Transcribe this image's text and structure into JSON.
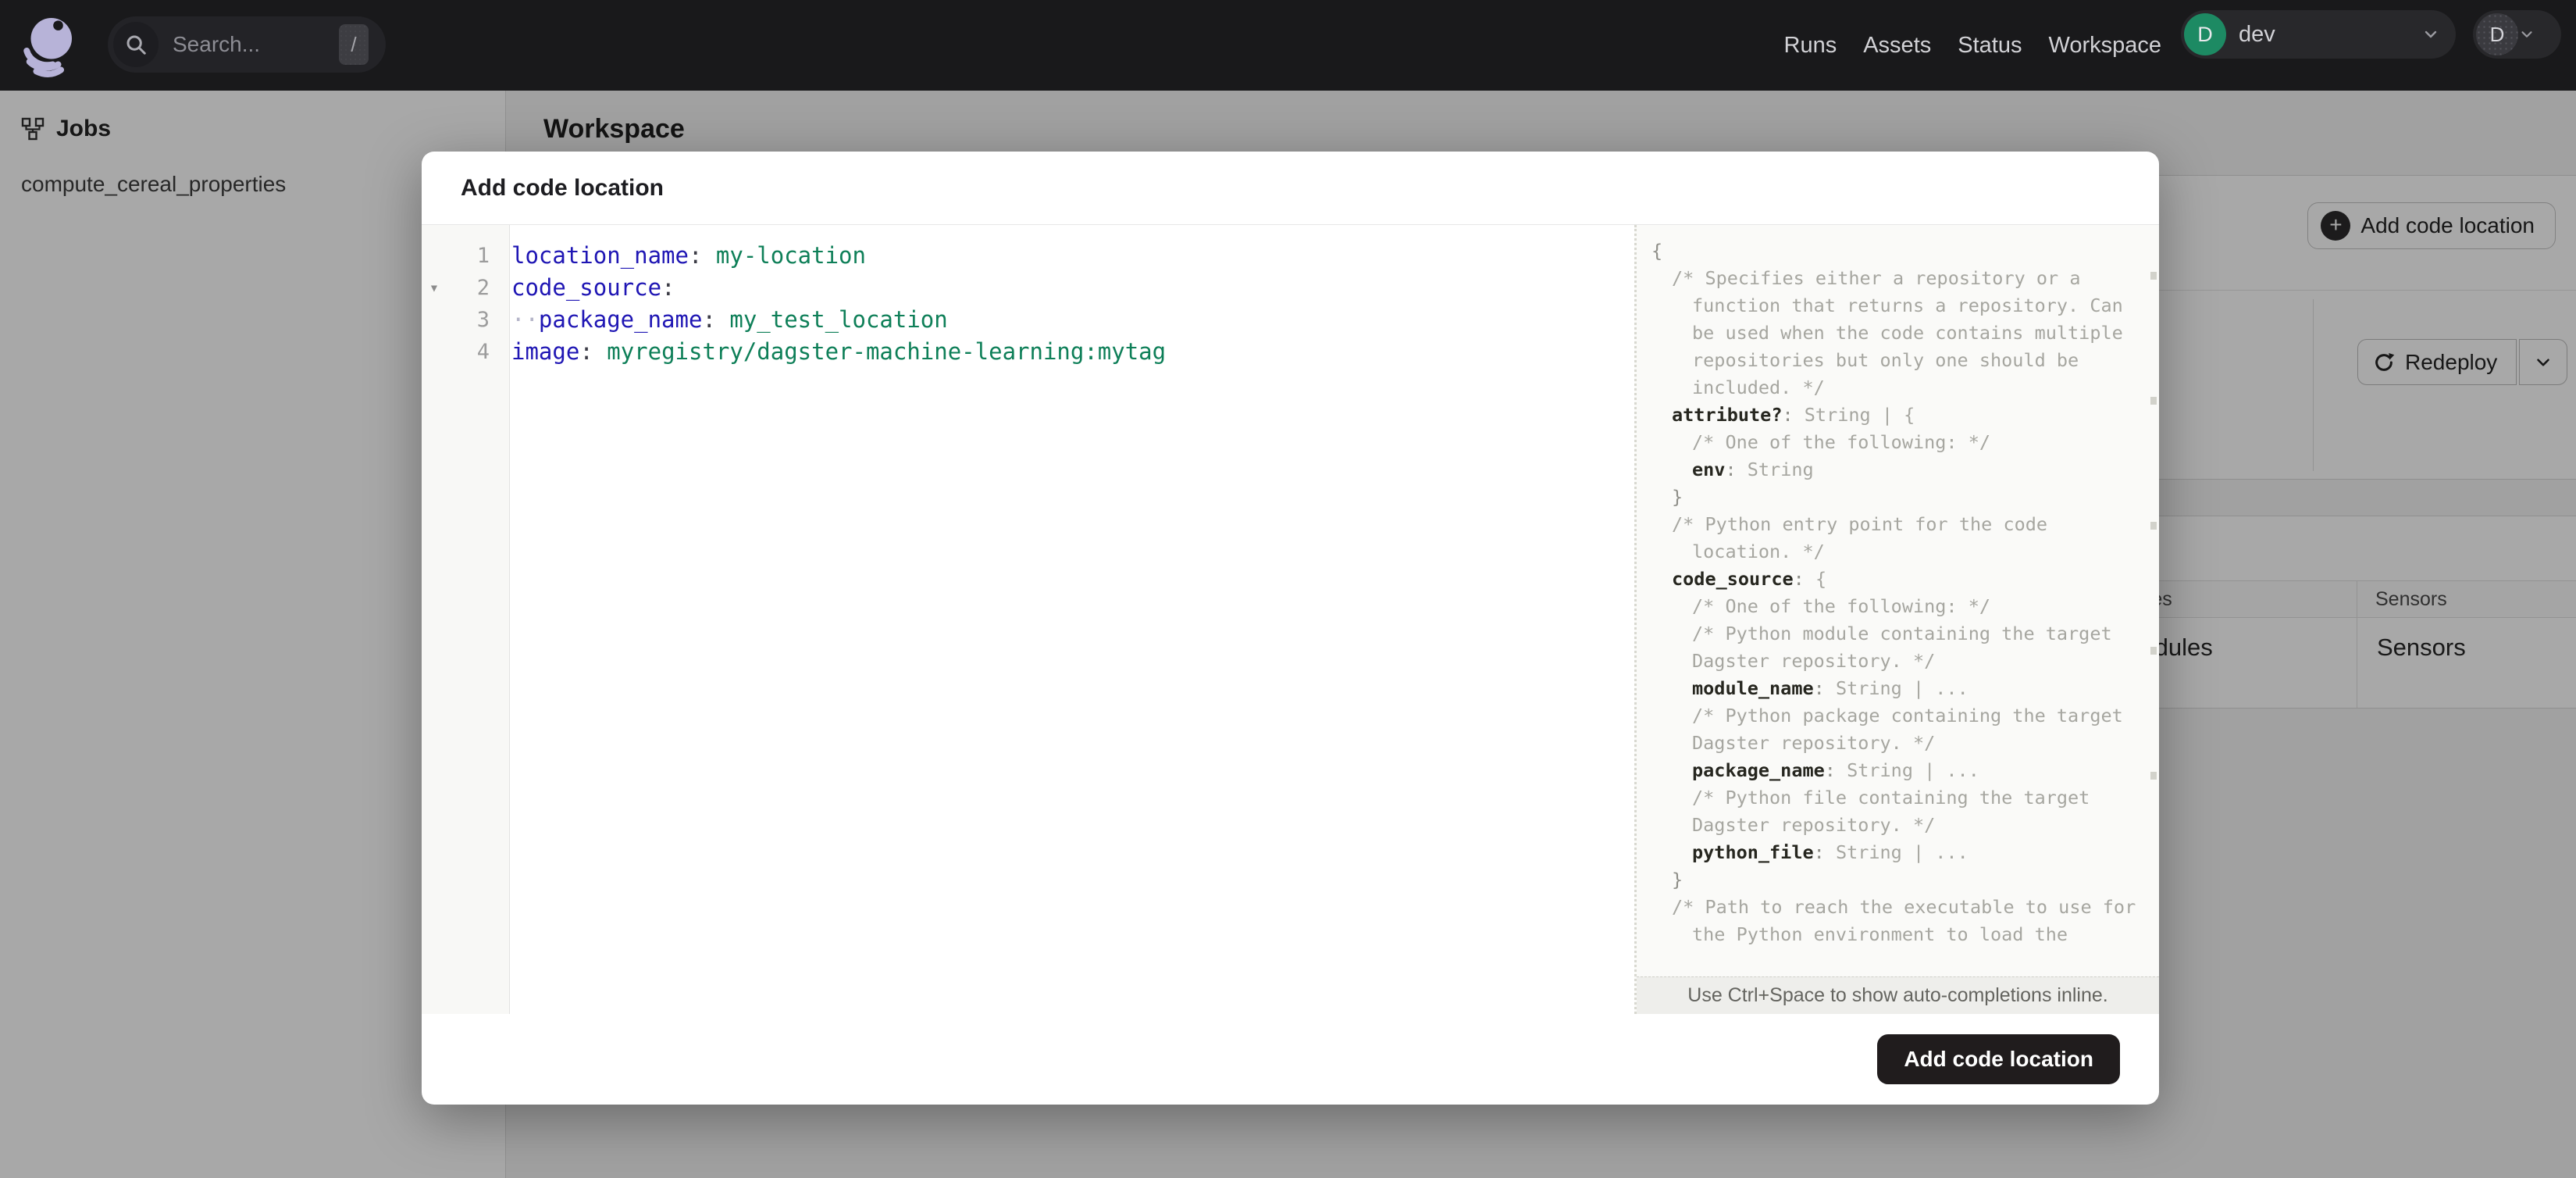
{
  "nav": {
    "search_placeholder": "Search...",
    "search_shortcut": "/",
    "links": [
      "Runs",
      "Assets",
      "Status",
      "Workspace"
    ],
    "deployment": {
      "initial": "D",
      "name": "dev"
    },
    "user_initial": "D"
  },
  "sidebar": {
    "section_title": "Jobs",
    "items": [
      "compute_cereal_properties"
    ]
  },
  "workspace_page": {
    "title": "Workspace",
    "add_button_label": "Add code location",
    "redeploy_label": "Redeploy",
    "table": {
      "header_schedules": "Schedules",
      "header_sensors": "Sensors",
      "row_schedules": "Schedules",
      "row_sensors": "Sensors"
    }
  },
  "modal": {
    "title": "Add code location",
    "submit_label": "Add code location",
    "hint": "Use Ctrl+Space to show auto-completions inline.",
    "editor_lines": [
      {
        "num": "1",
        "fold": false,
        "parts": [
          {
            "s": "key",
            "t": "location_name"
          },
          {
            "s": "punc",
            "t": ":"
          },
          {
            "s": "val",
            "t": " my-location"
          }
        ]
      },
      {
        "num": "2",
        "fold": true,
        "parts": [
          {
            "s": "key",
            "t": "code_source"
          },
          {
            "s": "punc",
            "t": ":"
          }
        ]
      },
      {
        "num": "3",
        "fold": false,
        "parts": [
          {
            "s": "ws",
            "t": "··"
          },
          {
            "s": "key",
            "t": "package_name"
          },
          {
            "s": "punc",
            "t": ":"
          },
          {
            "s": "val",
            "t": " my_test_location"
          }
        ]
      },
      {
        "num": "4",
        "fold": false,
        "parts": [
          {
            "s": "key",
            "t": "image"
          },
          {
            "s": "punc",
            "t": ":"
          },
          {
            "s": "val",
            "t": " myregistry/dagster-machine-learning:mytag"
          }
        ]
      }
    ],
    "schema_lines": [
      {
        "indent": 0,
        "parts": [
          {
            "s": "punc",
            "t": "{"
          }
        ]
      },
      {
        "indent": 1,
        "parts": [
          {
            "s": "comment",
            "t": "/* Specifies either a repository or a"
          }
        ]
      },
      {
        "indent": 2,
        "parts": [
          {
            "s": "comment",
            "t": "function that returns a repository. Can"
          }
        ]
      },
      {
        "indent": 2,
        "parts": [
          {
            "s": "comment",
            "t": "be used when the code contains multiple"
          }
        ]
      },
      {
        "indent": 2,
        "parts": [
          {
            "s": "comment",
            "t": "repositories but only one should be"
          }
        ]
      },
      {
        "indent": 2,
        "parts": [
          {
            "s": "comment",
            "t": "included. */"
          }
        ]
      },
      {
        "indent": 1,
        "parts": [
          {
            "s": "key",
            "t": "attribute?"
          },
          {
            "s": "punc",
            "t": ": "
          },
          {
            "s": "type",
            "t": "String | {"
          }
        ]
      },
      {
        "indent": 2,
        "parts": [
          {
            "s": "comment",
            "t": "/* One of the following: */"
          }
        ]
      },
      {
        "indent": 2,
        "parts": [
          {
            "s": "key",
            "t": "env"
          },
          {
            "s": "punc",
            "t": ": "
          },
          {
            "s": "type",
            "t": "String"
          }
        ]
      },
      {
        "indent": 1,
        "parts": [
          {
            "s": "punc",
            "t": "}"
          }
        ]
      },
      {
        "indent": 1,
        "parts": [
          {
            "s": "comment",
            "t": "/* Python entry point for the code"
          }
        ]
      },
      {
        "indent": 2,
        "parts": [
          {
            "s": "comment",
            "t": "location. */"
          }
        ]
      },
      {
        "indent": 1,
        "parts": [
          {
            "s": "key",
            "t": "code_source"
          },
          {
            "s": "punc",
            "t": ": "
          },
          {
            "s": "type",
            "t": "{"
          }
        ]
      },
      {
        "indent": 2,
        "parts": [
          {
            "s": "comment",
            "t": "/* One of the following: */"
          }
        ]
      },
      {
        "indent": 2,
        "parts": [
          {
            "s": "comment",
            "t": "/* Python module containing the target"
          }
        ]
      },
      {
        "indent": 2,
        "parts": [
          {
            "s": "comment",
            "t": "Dagster repository. */"
          }
        ]
      },
      {
        "indent": 2,
        "parts": [
          {
            "s": "key",
            "t": "module_name"
          },
          {
            "s": "punc",
            "t": ": "
          },
          {
            "s": "type",
            "t": "String | ..."
          }
        ]
      },
      {
        "indent": 2,
        "parts": [
          {
            "s": "comment",
            "t": "/* Python package containing the target"
          }
        ]
      },
      {
        "indent": 2,
        "parts": [
          {
            "s": "comment",
            "t": "Dagster repository. */"
          }
        ]
      },
      {
        "indent": 2,
        "parts": [
          {
            "s": "key",
            "t": "package_name"
          },
          {
            "s": "punc",
            "t": ": "
          },
          {
            "s": "type",
            "t": "String | ..."
          }
        ]
      },
      {
        "indent": 2,
        "parts": [
          {
            "s": "comment",
            "t": "/* Python file containing the target"
          }
        ]
      },
      {
        "indent": 2,
        "parts": [
          {
            "s": "comment",
            "t": "Dagster repository. */"
          }
        ]
      },
      {
        "indent": 2,
        "parts": [
          {
            "s": "key",
            "t": "python_file"
          },
          {
            "s": "punc",
            "t": ": "
          },
          {
            "s": "type",
            "t": "String | ..."
          }
        ]
      },
      {
        "indent": 1,
        "parts": [
          {
            "s": "punc",
            "t": "}"
          }
        ]
      },
      {
        "indent": 1,
        "parts": [
          {
            "s": "comment",
            "t": "/* Path to reach the executable to use for"
          }
        ]
      },
      {
        "indent": 2,
        "parts": [
          {
            "s": "comment",
            "t": "the Python environment to load the"
          }
        ]
      }
    ]
  },
  "colors": {
    "navbar_bg": "#19191b",
    "accent_green": "#1d8a63",
    "yaml_key_blue": "#1f16b4",
    "yaml_value_teal": "#0e7f58",
    "submit_button_bg": "#201c1d",
    "overlay": "rgba(0,0,0,0.34)"
  }
}
